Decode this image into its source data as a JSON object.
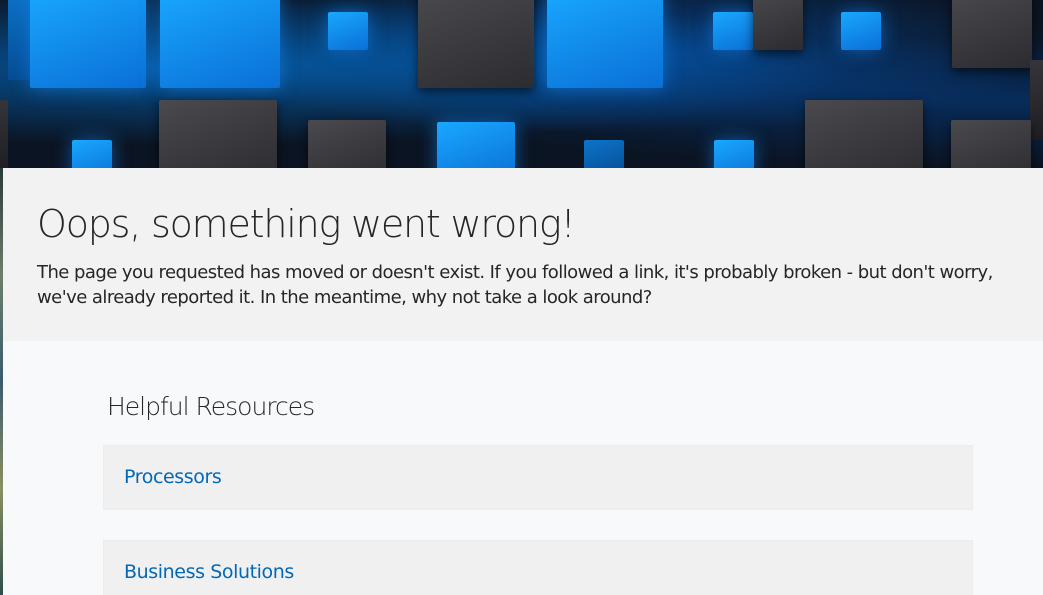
{
  "error": {
    "title": "Oops, something went wrong!",
    "message": "The page you requested has moved or doesn't exist. If you followed a link, it's probably broken - but don't worry, we've already reported it. In the meantime, why not take a look around?"
  },
  "resources": {
    "heading": "Helpful Resources",
    "items": [
      {
        "label": "Processors"
      },
      {
        "label": "Business Solutions"
      }
    ]
  },
  "colors": {
    "link": "#0068b5",
    "text": "#262626",
    "error_bg": "#f2f2f2",
    "resources_bg": "#f8f9fb",
    "card_bg": "#f0f0f0"
  }
}
